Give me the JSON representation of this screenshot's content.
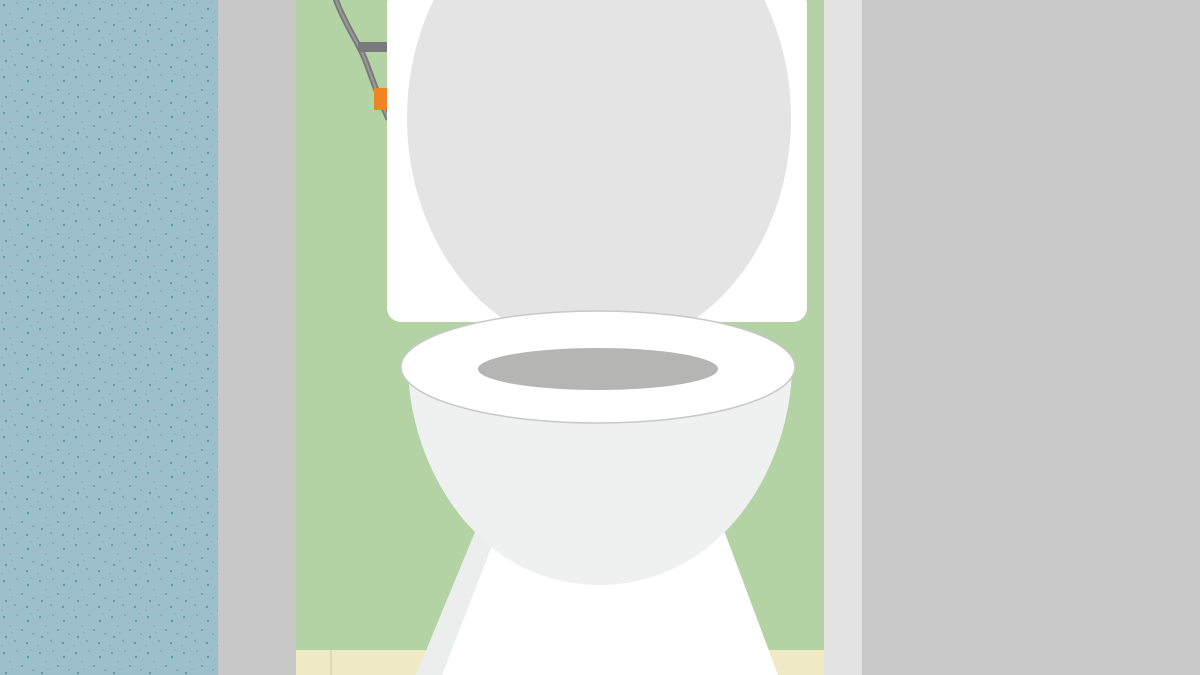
{
  "scene": {
    "subject": "toilet",
    "colors": {
      "left_wall": "#9dbfcc",
      "left_wall_speckle": "#5e97a7",
      "door_frame": "#c7c8c7",
      "door_trim": "#e2e3e2",
      "right_wall": "#c8c9c8",
      "back_wall": "#b3d3a5",
      "floor": "#efe9c6",
      "porcelain_white": "#ffffff",
      "porcelain_shade": "#eceeed",
      "lid": "#e3e4e3",
      "bowl_opening": "#b5b5b4",
      "pipe": "#7a7a7a",
      "valve": "#f08323"
    }
  }
}
